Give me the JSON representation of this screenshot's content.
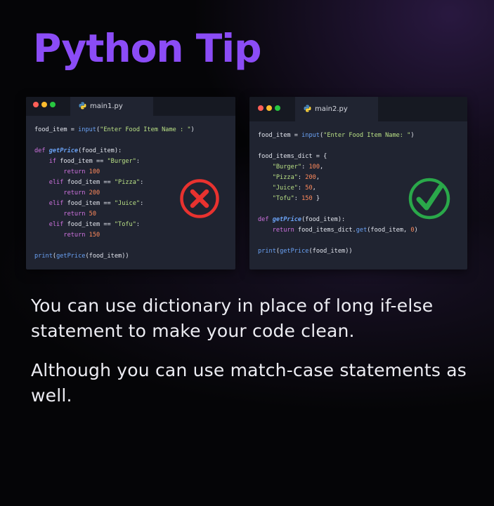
{
  "title": "Python Tip",
  "window1": {
    "filename": "main1.py",
    "code": [
      [
        {
          "t": "food_item = ",
          "c": ""
        },
        {
          "t": "input",
          "c": "fn"
        },
        {
          "t": "(",
          "c": ""
        },
        {
          "t": "\"Enter Food Item Name : \"",
          "c": "str"
        },
        {
          "t": ")",
          "c": ""
        }
      ],
      [],
      [
        {
          "t": "def ",
          "c": "kw"
        },
        {
          "t": "getPrice",
          "c": "def-name"
        },
        {
          "t": "(food_item):",
          "c": ""
        }
      ],
      [
        {
          "t": "    ",
          "c": ""
        },
        {
          "t": "if",
          "c": "kw"
        },
        {
          "t": " food_item == ",
          "c": ""
        },
        {
          "t": "\"Burger\"",
          "c": "str"
        },
        {
          "t": ":",
          "c": ""
        }
      ],
      [
        {
          "t": "        ",
          "c": ""
        },
        {
          "t": "return",
          "c": "kw"
        },
        {
          "t": " ",
          "c": ""
        },
        {
          "t": "100",
          "c": "num"
        }
      ],
      [
        {
          "t": "    ",
          "c": ""
        },
        {
          "t": "elif",
          "c": "kw"
        },
        {
          "t": " food_item == ",
          "c": ""
        },
        {
          "t": "\"Pizza\"",
          "c": "str"
        },
        {
          "t": ":",
          "c": ""
        }
      ],
      [
        {
          "t": "        ",
          "c": ""
        },
        {
          "t": "return",
          "c": "kw"
        },
        {
          "t": " ",
          "c": ""
        },
        {
          "t": "200",
          "c": "num"
        }
      ],
      [
        {
          "t": "    ",
          "c": ""
        },
        {
          "t": "elif",
          "c": "kw"
        },
        {
          "t": " food_item == ",
          "c": ""
        },
        {
          "t": "\"Juice\"",
          "c": "str"
        },
        {
          "t": ":",
          "c": ""
        }
      ],
      [
        {
          "t": "        ",
          "c": ""
        },
        {
          "t": "return",
          "c": "kw"
        },
        {
          "t": " ",
          "c": ""
        },
        {
          "t": "50",
          "c": "num"
        }
      ],
      [
        {
          "t": "    ",
          "c": ""
        },
        {
          "t": "elif",
          "c": "kw"
        },
        {
          "t": " food_item == ",
          "c": ""
        },
        {
          "t": "\"Tofu\"",
          "c": "str"
        },
        {
          "t": ":",
          "c": ""
        }
      ],
      [
        {
          "t": "        ",
          "c": ""
        },
        {
          "t": "return",
          "c": "kw"
        },
        {
          "t": " ",
          "c": ""
        },
        {
          "t": "150",
          "c": "num"
        }
      ],
      [],
      [
        {
          "t": "print",
          "c": "fn"
        },
        {
          "t": "(",
          "c": ""
        },
        {
          "t": "getPrice",
          "c": "fn"
        },
        {
          "t": "(food_item))",
          "c": ""
        }
      ]
    ],
    "badge_icon": "x-circle-icon",
    "badge_color": "#e8322f"
  },
  "window2": {
    "filename": "main2.py",
    "code": [
      [
        {
          "t": "food_item = ",
          "c": ""
        },
        {
          "t": "input",
          "c": "fn"
        },
        {
          "t": "(",
          "c": ""
        },
        {
          "t": "\"Enter Food Item Name: \"",
          "c": "str"
        },
        {
          "t": ")",
          "c": ""
        }
      ],
      [],
      [
        {
          "t": "food_items_dict = {",
          "c": ""
        }
      ],
      [
        {
          "t": "    ",
          "c": ""
        },
        {
          "t": "\"Burger\"",
          "c": "str"
        },
        {
          "t": ": ",
          "c": ""
        },
        {
          "t": "100",
          "c": "num"
        },
        {
          "t": ",",
          "c": ""
        }
      ],
      [
        {
          "t": "    ",
          "c": ""
        },
        {
          "t": "\"Pizza\"",
          "c": "str"
        },
        {
          "t": ": ",
          "c": ""
        },
        {
          "t": "200",
          "c": "num"
        },
        {
          "t": ",",
          "c": ""
        }
      ],
      [
        {
          "t": "    ",
          "c": ""
        },
        {
          "t": "\"Juice\"",
          "c": "str"
        },
        {
          "t": ": ",
          "c": ""
        },
        {
          "t": "50",
          "c": "num"
        },
        {
          "t": ",",
          "c": ""
        }
      ],
      [
        {
          "t": "    ",
          "c": ""
        },
        {
          "t": "\"Tofu\"",
          "c": "str"
        },
        {
          "t": ": ",
          "c": ""
        },
        {
          "t": "150",
          "c": "num"
        },
        {
          "t": " }",
          "c": ""
        }
      ],
      [],
      [
        {
          "t": "def ",
          "c": "kw"
        },
        {
          "t": "getPrice",
          "c": "def-name"
        },
        {
          "t": "(food_item):",
          "c": ""
        }
      ],
      [
        {
          "t": "    ",
          "c": ""
        },
        {
          "t": "return",
          "c": "kw"
        },
        {
          "t": " food_items_dict.",
          "c": ""
        },
        {
          "t": "get",
          "c": "fn"
        },
        {
          "t": "(food_item, ",
          "c": ""
        },
        {
          "t": "0",
          "c": "num"
        },
        {
          "t": ")",
          "c": ""
        }
      ],
      [],
      [
        {
          "t": "print",
          "c": "fn"
        },
        {
          "t": "(",
          "c": ""
        },
        {
          "t": "getPrice",
          "c": "fn"
        },
        {
          "t": "(food_item))",
          "c": ""
        }
      ]
    ],
    "badge_icon": "check-circle-icon",
    "badge_color": "#2aa84a"
  },
  "window_dot_colors": [
    "#ff5f57",
    "#febc2e",
    "#28c840"
  ],
  "accent_color": "#8b4cf6",
  "caption1": "You can use dictionary in place of long if-else statement to make your code clean.",
  "caption2": "Although you can use match-case statements as well."
}
